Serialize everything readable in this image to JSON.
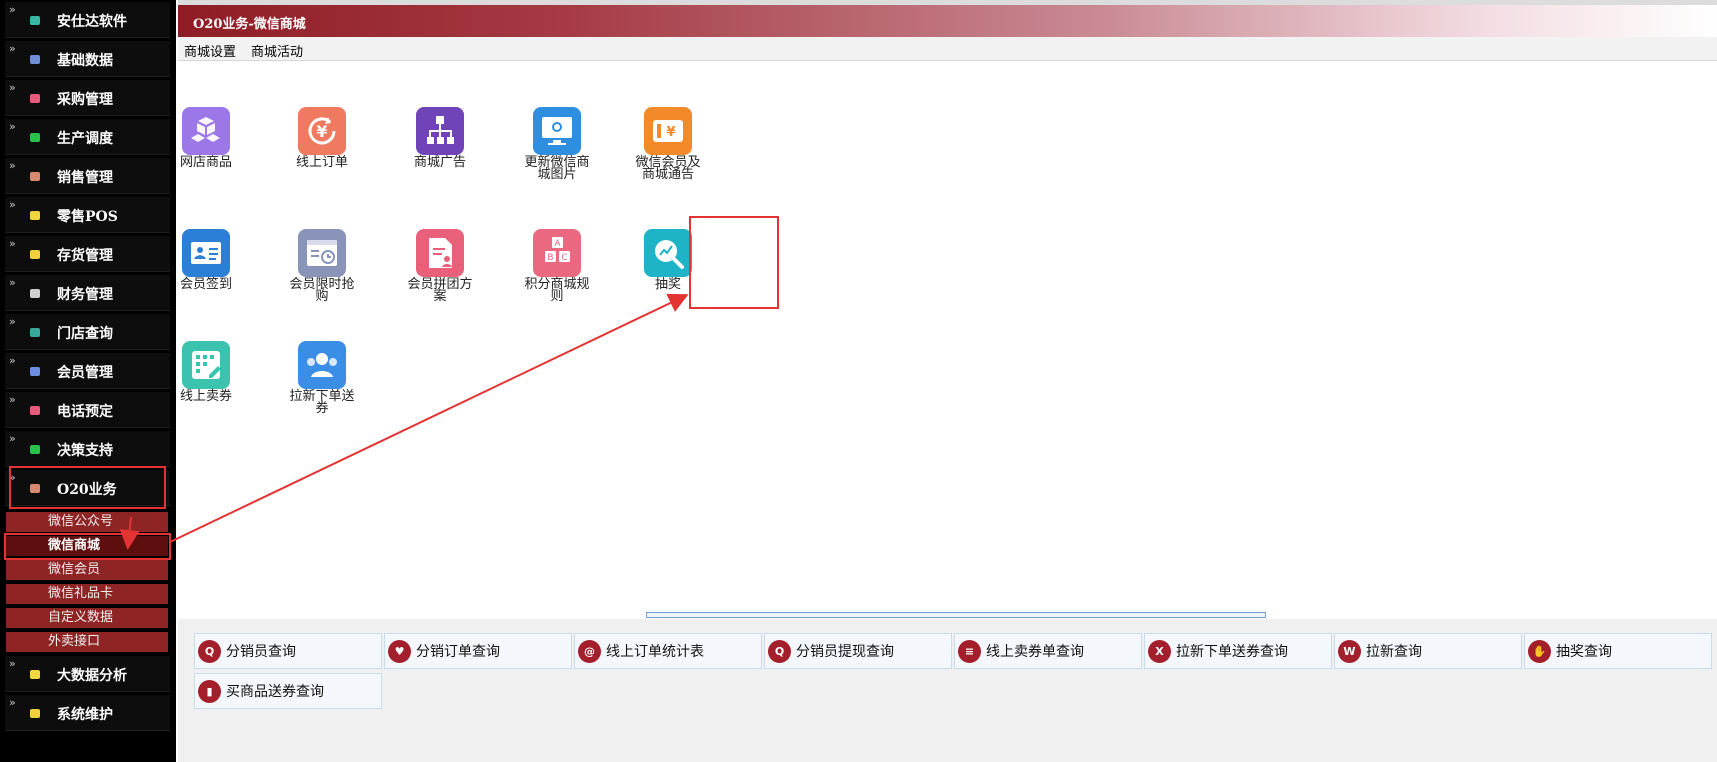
{
  "sidebar": {
    "arrow_glyph": "»",
    "items": [
      {
        "label": "安仕达软件",
        "icon": "teal-square-icon",
        "color": "#39b8a6"
      },
      {
        "label": "基础数据",
        "icon": "blue-square-icon",
        "color": "#6e8fd8"
      },
      {
        "label": "采购管理",
        "icon": "pink-square-icon",
        "color": "#e45b7c"
      },
      {
        "label": "生产调度",
        "icon": "green-square-icon",
        "color": "#28c24a"
      },
      {
        "label": "销售管理",
        "icon": "brown-square-icon",
        "color": "#d98a6e"
      },
      {
        "label": "零售POS",
        "icon": "yellow-square-icon",
        "color": "#f2d640"
      },
      {
        "label": "存货管理",
        "icon": "yellow-square-icon",
        "color": "#f2cf3c"
      },
      {
        "label": "财务管理",
        "icon": "gray-square-icon",
        "color": "#cfcfcf"
      },
      {
        "label": "门店查询",
        "icon": "teal-square-icon",
        "color": "#3aa898"
      },
      {
        "label": "会员管理",
        "icon": "blue-square-icon",
        "color": "#6b8fe0"
      },
      {
        "label": "电话预定",
        "icon": "pink-square-icon",
        "color": "#e45b7c"
      },
      {
        "label": "决策支持",
        "icon": "green-square-icon",
        "color": "#28c24a"
      },
      {
        "label": "O20业务",
        "icon": "brown-square-icon",
        "color": "#d98a6e"
      }
    ],
    "sub_items": [
      {
        "label": "微信公众号"
      },
      {
        "label": "微信商城"
      },
      {
        "label": "微信会员"
      },
      {
        "label": "微信礼品卡"
      },
      {
        "label": "自定义数据"
      },
      {
        "label": "外卖接口"
      }
    ],
    "after_items": [
      {
        "label": "大数据分析",
        "icon": "yellow-square-icon",
        "color": "#f2d640"
      },
      {
        "label": "系统维护",
        "icon": "yellow-square-icon",
        "color": "#f2cf3c"
      }
    ]
  },
  "titlebar": {
    "title": "O20业务-微信商城"
  },
  "menubar": {
    "items": [
      "商城设置",
      "商城活动"
    ]
  },
  "apps": [
    {
      "label": "网店商品",
      "icon": "cubes-icon",
      "color": "#9b77e8"
    },
    {
      "label": "线上订单",
      "icon": "yuan-refresh-icon",
      "color": "#f07a60"
    },
    {
      "label": "商城广告",
      "icon": "org-chart-icon",
      "color": "#7043b8"
    },
    {
      "label": "更新微信商城图片",
      "icon": "monitor-gear-icon",
      "color": "#2e8fe0"
    },
    {
      "label": "微信会员及商城通告",
      "icon": "yuan-ticket-icon",
      "color": "#f28a2a"
    },
    {
      "label": "会员签到",
      "icon": "id-card-icon",
      "color": "#2b7fd6"
    },
    {
      "label": "会员限时抢购",
      "icon": "clock-window-icon",
      "color": "#8a94b8"
    },
    {
      "label": "会员拼团方案",
      "icon": "document-user-icon",
      "color": "#e8607a"
    },
    {
      "label": "积分商城规则",
      "icon": "abc-blocks-icon",
      "color": "#ea6880"
    },
    {
      "label": "抽奖",
      "icon": "magnifier-chart-icon",
      "color": "#1fb3c8"
    },
    {
      "label": "线上卖券",
      "icon": "grid-pen-icon",
      "color": "#3cc3b0"
    },
    {
      "label": "拉新下单送券",
      "icon": "user-group-icon",
      "color": "#3a8ee6"
    }
  ],
  "quick_links": [
    {
      "label": "分销员查询",
      "icon": "search-user-icon",
      "glyph": "Q"
    },
    {
      "label": "分销订单查询",
      "icon": "heart-icon",
      "glyph": "♥"
    },
    {
      "label": "线上订单统计表",
      "icon": "report-icon",
      "glyph": "@"
    },
    {
      "label": "分销员提现查询",
      "icon": "search-icon",
      "glyph": "Q"
    },
    {
      "label": "线上卖券单查询",
      "icon": "clipboard-icon",
      "glyph": "≡"
    },
    {
      "label": "拉新下单送券查询",
      "icon": "x-icon",
      "glyph": "X"
    },
    {
      "label": "拉新查询",
      "icon": "new-badge-icon",
      "glyph": "W"
    },
    {
      "label": "抽奖查询",
      "icon": "hands-icon",
      "glyph": "✋"
    },
    {
      "label": "买商品送券查询",
      "icon": "bar-chart-icon",
      "glyph": "▮"
    }
  ],
  "colors": {
    "accent": "#8e1c24",
    "annotation": "#e33333"
  }
}
